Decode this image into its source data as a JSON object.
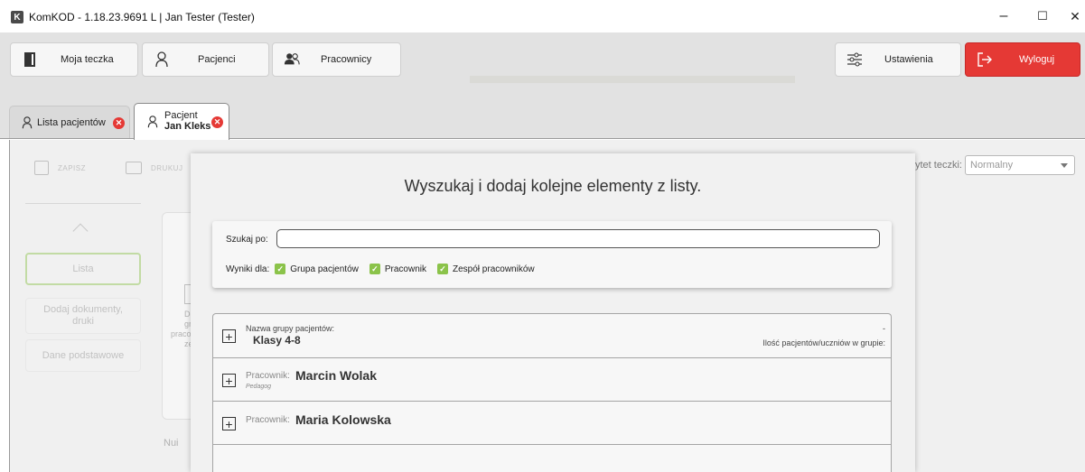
{
  "window": {
    "logo_letter": "K",
    "title": "KomKOD - 1.18.23.9691 L | Jan Tester (Tester)",
    "minimize": "–",
    "maximize": "☐",
    "close": "✕"
  },
  "nav": {
    "my_folder": "Moja teczka",
    "patients": "Pacjenci",
    "employees": "Pracownicy",
    "settings": "Ustawienia",
    "logout": "Wyloguj"
  },
  "tabs": [
    {
      "label": "Lista pacjentów"
    },
    {
      "label_line1": "Pacjent",
      "label_line2": "Jan Kleks"
    }
  ],
  "toolbar": {
    "save": "ZAPISZ",
    "print": "DRUKUJ",
    "priority_label": "ytet teczki:",
    "priority_value": "Normalny"
  },
  "sidebar": {
    "items": [
      "Lista",
      "Dodaj dokumenty, druki",
      "Dane podstawowe"
    ]
  },
  "behind": {
    "frag1": "De",
    "frag2": "gr",
    "frag3": "praco",
    "frag4": "ze",
    "num": "Nui"
  },
  "modal": {
    "title": "Wyszukaj i dodaj kolejne elementy z listy.",
    "search_label": "Szukaj po:",
    "search_value": "",
    "results_for": "Wyniki dla:",
    "filters": [
      "Grupa pacjentów",
      "Pracownik",
      "Zespół pracowników"
    ],
    "rows": [
      {
        "prefix": "Nazwa grupy pacjentów:",
        "name": "Klasy 4-8",
        "right_top": "-",
        "right_label": "Ilość pacjentów/uczniów w grupie:"
      },
      {
        "prefix": "Pracownik:",
        "name": "Marcin Wolak",
        "sub": "Pedagog"
      },
      {
        "prefix": "Pracownik:",
        "name": "Maria Kolowska"
      }
    ]
  },
  "colors": {
    "accent_green": "#8bc34a",
    "logout_red": "#e53935",
    "close_red": "#e53935"
  }
}
